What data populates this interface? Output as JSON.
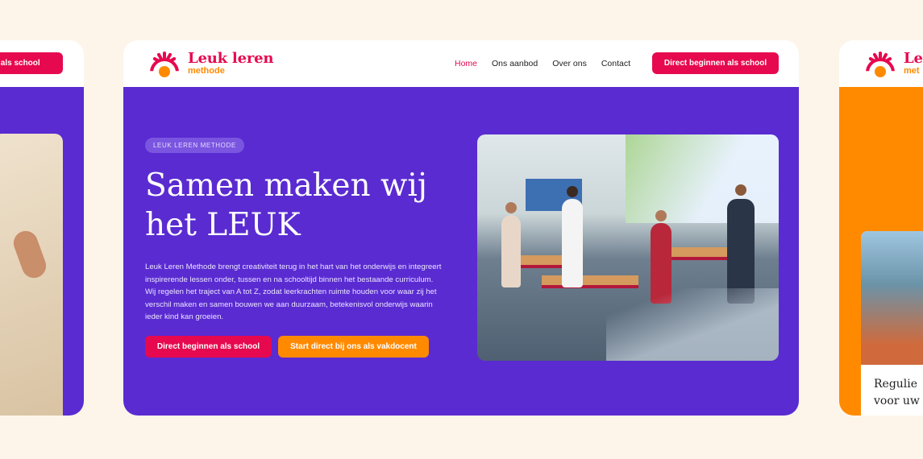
{
  "brand": {
    "title": "Leuk leren",
    "subtitle": "methode"
  },
  "nav": {
    "items": [
      {
        "label": "Home",
        "active": true
      },
      {
        "label": "Ons aanbod",
        "active": false
      },
      {
        "label": "Over ons",
        "active": false
      },
      {
        "label": "Contact",
        "active": false
      }
    ],
    "cta_label": "Direct beginnen als school"
  },
  "left_card": {
    "cta_label": "en als school"
  },
  "hero": {
    "badge": "LEUK LEREN METHODE",
    "headline_line1": "Samen maken wij",
    "headline_line2": "het LEUK",
    "paragraph": "Leuk Leren Methode brengt creativiteit terug in het hart van het onderwijs en integreert inspirerende lessen onder, tussen en na schooltijd binnen het bestaande curriculum. Wij regelen het traject van A tot Z, zodat leerkrachten ruimte houden voor waar zij het verschil maken en samen bouwen we aan duurzaam, betekenisvol onderwijs waarin ieder kind kan groeien.",
    "primary_button": "Direct beginnen als school",
    "secondary_button": "Start direct bij ons als vakdocent"
  },
  "right_card": {
    "brand_title": "Leu",
    "brand_subtitle": "met",
    "text_line1": "Regulie",
    "text_line2": "voor uw"
  },
  "colors": {
    "background": "#fdf5ea",
    "purple": "#5a2bd1",
    "pink": "#e6094f",
    "orange": "#ff8a00"
  }
}
